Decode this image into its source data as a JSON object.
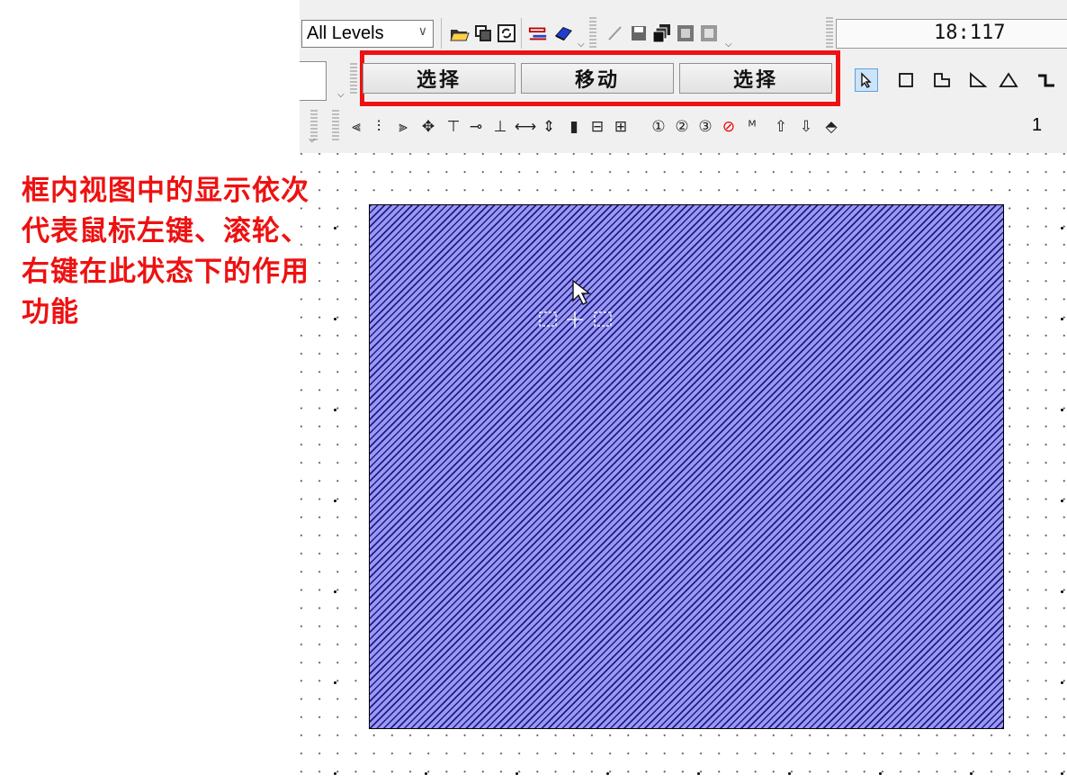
{
  "annotation": {
    "text": "框内视图中的显示依次代表鼠标左键、滚轮、右键在此状态下的作用功能"
  },
  "toolbar": {
    "level_select_value": "All Levels",
    "time_display": "18:117",
    "mouse_buttons": {
      "left": "选择",
      "wheel": "移动",
      "right": "选择"
    },
    "number_field": "1"
  },
  "icons": {
    "row1": [
      "open-folder-icon",
      "copy-icon",
      "refresh-icon",
      "layers-icon",
      "book-icon",
      "pencil-icon",
      "save-icon",
      "save-all-icon",
      "export-icon",
      "import-icon"
    ],
    "row2": [
      "select-arrow-icon",
      "rectangle-icon",
      "rect-corner-icon",
      "trapezoid-icon",
      "triangle-icon",
      "wire-icon"
    ],
    "row3": [
      "align-left-icon",
      "align-center-icon",
      "align-right-icon",
      "distribute-icon",
      "align-top-icon",
      "link-icon",
      "align-bottom-icon",
      "spacing-h-icon",
      "spacing-v-icon",
      "group-icon",
      "ungroup-icon",
      "grid-icon",
      "marker-1-icon",
      "marker-2-icon",
      "marker-3-icon",
      "no-marker-icon",
      "mfg-icon",
      "up-marker-icon",
      "down-marker-icon",
      "place-icon"
    ]
  },
  "colors": {
    "highlight_border": "#ee1111",
    "annotation_text": "#ee1111",
    "shape_fill": "#9a98f0",
    "shape_hatch": "#1c1c8a"
  }
}
